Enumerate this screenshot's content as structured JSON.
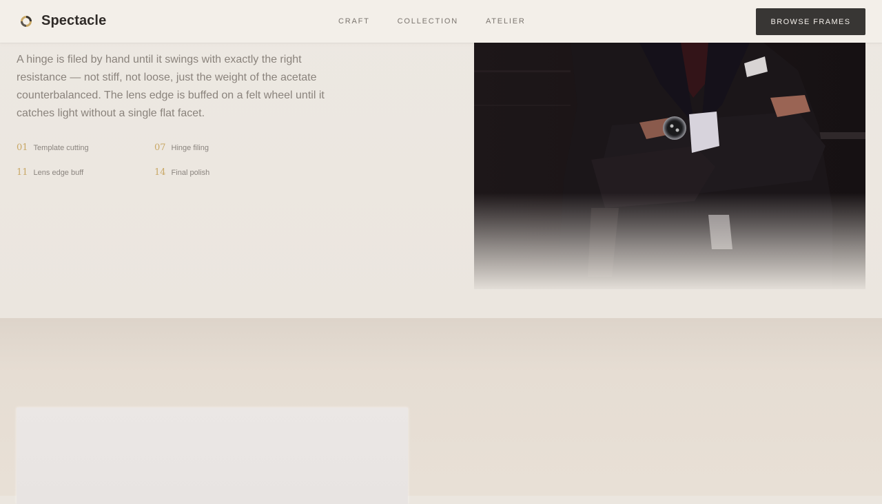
{
  "brand": {
    "name": "Spectacle",
    "logo_icon": "ring-logo-icon"
  },
  "nav": [
    {
      "label": "CRAFT"
    },
    {
      "label": "COLLECTION"
    },
    {
      "label": "ATELIER"
    }
  ],
  "cta": {
    "label": "BROWSE FRAMES"
  },
  "craft": {
    "lead": "A hinge is filed by hand until it swings with exactly the right resistance — not stiff, not loose, just the weight of the acetate counterbalanced. The lens edge is buffed on a felt wheel until it catches light without a single flat facet.",
    "steps": [
      {
        "num": "01",
        "label": "Template cutting"
      },
      {
        "num": "07",
        "label": "Hinge filing"
      },
      {
        "num": "11",
        "label": "Lens edge buff"
      },
      {
        "num": "14",
        "label": "Final polish"
      }
    ],
    "photo_subject": "man in dark suit with wristwatch, arms crossed"
  },
  "colors": {
    "accent": "#c9a866",
    "button_bg": "#383634",
    "text_muted": "#8a837c",
    "background": "#ebe6df"
  }
}
